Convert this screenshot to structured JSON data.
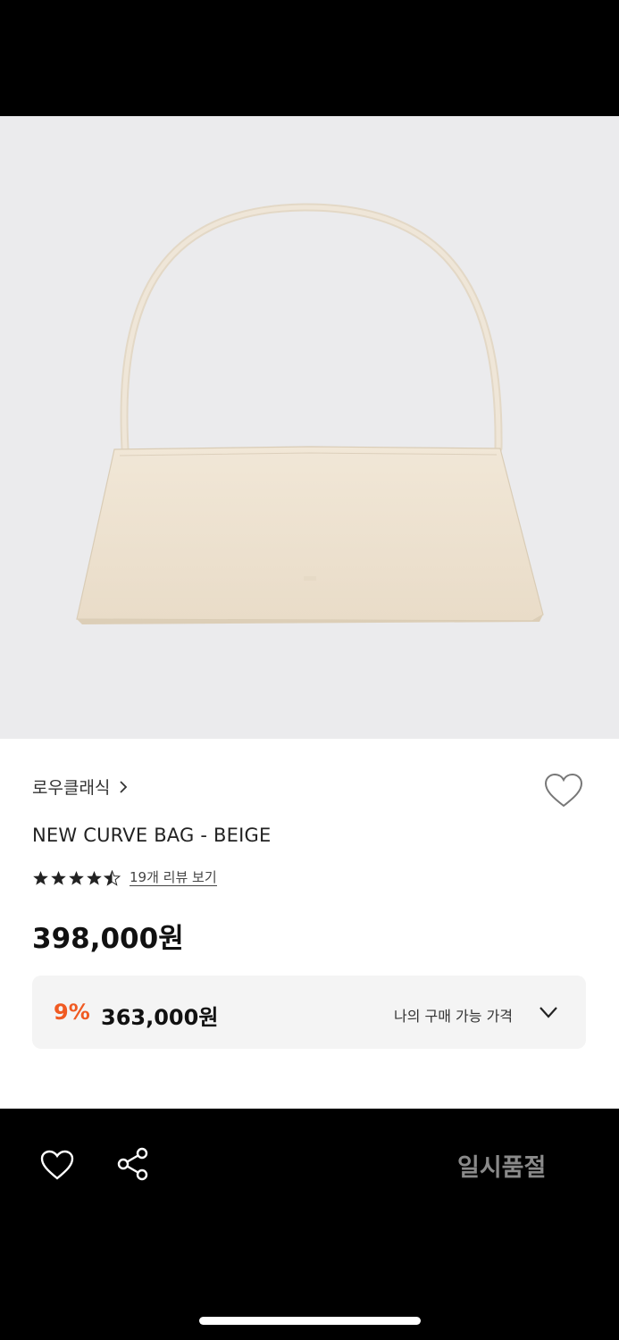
{
  "brand": {
    "name": "로우클래식",
    "chevron": "chevron-right-icon"
  },
  "product": {
    "name": "NEW CURVE BAG - BEIGE",
    "image_desc_icon": "beige-shoulder-bag",
    "rating": 4.5,
    "rating_max": 5,
    "review_link": "19개 리뷰 보기",
    "price": "398,000원"
  },
  "member_price": {
    "discount": "9%",
    "price": "363,000원",
    "label": "나의 구매 가능 가격"
  },
  "bottom_bar": {
    "wish_icon": "heart-outline-icon",
    "share_icon": "share-icon",
    "status": "일시품절"
  },
  "colors": {
    "accent": "#f05a22",
    "hero_bg": "#ebebed",
    "bag": "#efe4d3",
    "soldout_text": "#8a8a8a"
  }
}
